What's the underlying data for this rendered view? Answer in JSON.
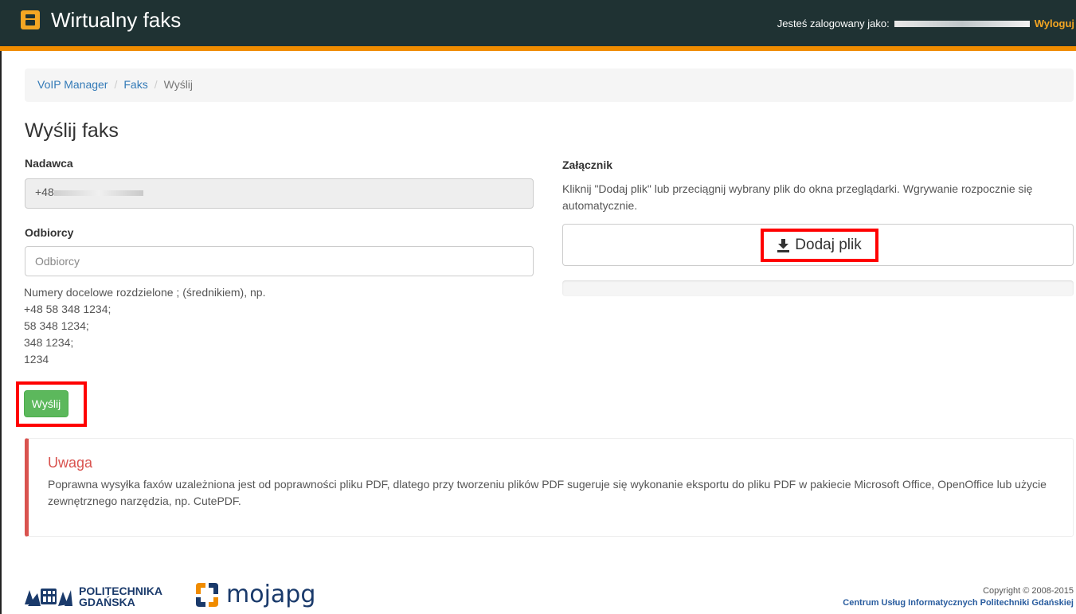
{
  "header": {
    "title": "Wirtualny faks",
    "logged_in_label": "Jesteś zalogowany jako:",
    "logout_label": "Wyloguj",
    "accent_color": "#f08c00",
    "bar_color": "#1f3233"
  },
  "breadcrumb": {
    "items": [
      "VoIP Manager",
      "Faks"
    ],
    "active": "Wyślij"
  },
  "page_title": "Wyślij faks",
  "sender": {
    "label": "Nadawca",
    "value_prefix": "+48"
  },
  "recipients": {
    "label": "Odbiorcy",
    "placeholder": "Odbiorcy",
    "help_lines": [
      "Numery docelowe rozdzielone ; (średnikiem), np.",
      "+48 58 348 1234;",
      "58 348 1234;",
      "348 1234;",
      "1234"
    ]
  },
  "send_button": "Wyślij",
  "attachment": {
    "label": "Załącznik",
    "description": "Kliknij \"Dodaj plik\" lub przeciągnij wybrany plik do okna przeglądarki. Wgrywanie rozpocznie się automatycznie.",
    "add_button": "Dodaj plik",
    "upload_progress": 0
  },
  "alert": {
    "title": "Uwaga",
    "body": "Poprawna wysyłka faxów uzależniona jest od poprawności pliku PDF, dlatego przy tworzeniu plików PDF sugeruje się wykonanie eksportu do pliku PDF w pakiecie Microsoft Office, OpenOffice lub użycie zewnętrznego narzędzia, np. CutePDF.",
    "color": "#d9534f"
  },
  "footer": {
    "logo1_line1": "POLITECHNIKA",
    "logo1_line2": "GDAŃSKA",
    "logo2_a": "moja",
    "logo2_b": "pg",
    "copyright": "Copyright © 2008-2015",
    "org": "Centrum Usług Informatycznych Politechniki Gdańskiej"
  }
}
